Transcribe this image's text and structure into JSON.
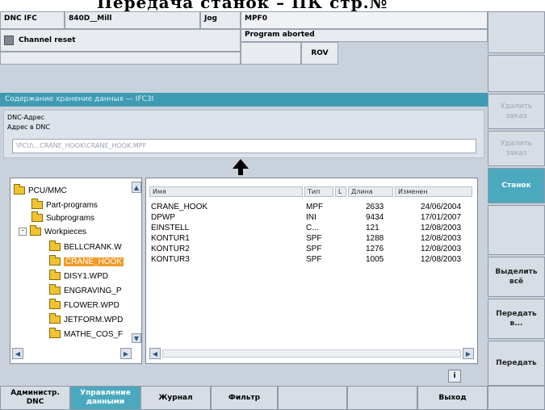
{
  "caption": "Передача станок – ПК стр.№",
  "header": {
    "row1": {
      "mode": "DNC IFC",
      "machine": "840D__Mill",
      "op_mode": "Jog",
      "program": "MPF0"
    },
    "row2": {
      "channel_status": "Channel reset",
      "program_status": "Program aborted"
    },
    "row3": {
      "rov": "ROV"
    }
  },
  "section_title": "Содержание хранение данных — IFC3I",
  "address": {
    "group_label": "DNC-Адрес",
    "field_label": "Адрес в DNC",
    "value": "\\PCU\\...CRANE_HOOK\\CRANE_HOOK.MPF"
  },
  "tree": {
    "items": [
      {
        "label": "PCU/MMC"
      },
      {
        "label": "Part-programs"
      },
      {
        "label": "Subprograms"
      },
      {
        "label": "Workpieces"
      },
      {
        "label": "BELLCRANK.W"
      },
      {
        "label": "CRANE_HOOK"
      },
      {
        "label": "DISY1.WPD"
      },
      {
        "label": "ENGRAVING_P"
      },
      {
        "label": "FLOWER.WPD"
      },
      {
        "label": "JETFORM.WPD"
      },
      {
        "label": "MATHE_COS_F"
      }
    ]
  },
  "file_list": {
    "columns": [
      "Имя",
      "Тип",
      "L",
      "Длина",
      "Изменен"
    ],
    "rows": [
      {
        "name": "CRANE_HOOK",
        "type": "MPF",
        "length": "2633",
        "changed": "24/06/2004"
      },
      {
        "name": "DPWP",
        "type": "INI",
        "length": "9434",
        "changed": "17/01/2007"
      },
      {
        "name": "EINSTELL",
        "type": "C...",
        "length": "121",
        "changed": "12/08/2003"
      },
      {
        "name": "KONTUR1",
        "type": "SPF",
        "length": "1288",
        "changed": "12/08/2003"
      },
      {
        "name": "KONTUR2",
        "type": "SPF",
        "length": "1276",
        "changed": "12/08/2003"
      },
      {
        "name": "KONTUR3",
        "type": "SPF",
        "length": "1005",
        "changed": "12/08/2003"
      }
    ]
  },
  "info_icon": "i",
  "softkeys_right": [
    {
      "label": "",
      "state": "normal"
    },
    {
      "label": "",
      "state": "normal"
    },
    {
      "label": "Удалить\nзаказ",
      "state": "dim"
    },
    {
      "label": "Удалить\nзаказ",
      "state": "dim"
    },
    {
      "label": "Станок",
      "state": "active"
    },
    {
      "label": "",
      "state": "normal"
    },
    {
      "label": "Выделить\nвсё",
      "state": "normal"
    },
    {
      "label": "Передать\nв...",
      "state": "normal"
    },
    {
      "label": "Передать",
      "state": "normal"
    }
  ],
  "softkeys_bottom": [
    {
      "label": "Администр.\nDNC",
      "state": "normal"
    },
    {
      "label": "Управление\nданными",
      "state": "active"
    },
    {
      "label": "Журнал",
      "state": "normal"
    },
    {
      "label": "Фильтр",
      "state": "normal"
    },
    {
      "label": "",
      "state": "normal"
    },
    {
      "label": "",
      "state": "normal"
    },
    {
      "label": "Выход",
      "state": "normal"
    },
    {
      "label": "",
      "state": "normal"
    }
  ],
  "colors": {
    "accent": "#3e9bb3",
    "selection": "#f39a25",
    "panel": "#c9d2dc"
  }
}
